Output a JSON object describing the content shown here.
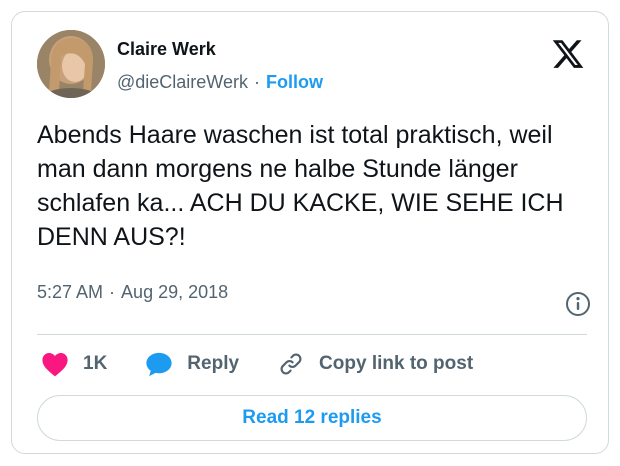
{
  "author": {
    "name": "Claire Werk",
    "handle": "@dieClaireWerk",
    "separator": "·",
    "follow_label": "Follow"
  },
  "tweet": {
    "text": "Abends Haare waschen ist total praktisch, weil man dann morgens ne halbe Stunde länger schlafen ka... ACH DU KACKE, WIE SEHE ICH DENN AUS?!",
    "time": "5:27 AM",
    "separator": "·",
    "date": "Aug 29, 2018"
  },
  "actions": {
    "likes_count": "1K",
    "reply_label": "Reply",
    "copy_label": "Copy link to post"
  },
  "replies_button": "Read 12 replies",
  "icons": {
    "logo": "x-logo-icon",
    "info": "info-icon",
    "like": "heart-icon",
    "reply": "speech-bubble-icon",
    "copy": "link-icon"
  },
  "colors": {
    "accent": "#1d9bf0",
    "like": "#f91880",
    "text": "#0f1419",
    "muted": "#536471",
    "border": "#cfd9de"
  }
}
